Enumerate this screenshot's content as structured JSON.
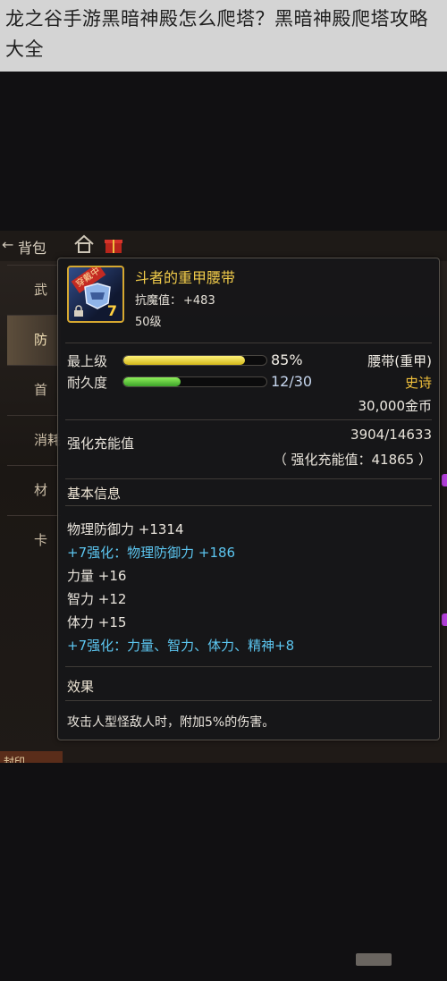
{
  "header": {
    "title": "龙之谷手游黑暗神殿怎么爬塔？黑暗神殿爬塔攻略大全"
  },
  "game": {
    "topbar": {
      "back_glyph": "←",
      "bag_label": "背包"
    },
    "sidebar": {
      "tabs": [
        "武",
        "防",
        "首",
        "消耗",
        "材",
        "卡"
      ],
      "bottom_label": "封印"
    },
    "item": {
      "badge": "穿戴中",
      "icon_level": "7",
      "name": "斗者的重甲腰带",
      "attr_label": "抗魔值：",
      "attr_value": "+483",
      "level": "50级",
      "top_level_label": "最上级",
      "top_level_value": "85%",
      "top_level_fraction": 0.85,
      "durability_label": "耐久度",
      "durability_value": "12/30",
      "durability_fraction": 0.4,
      "type": "腰带(重甲)",
      "rarity": "史诗",
      "price": "30,000金币",
      "charge_label": "强化充能值",
      "charge_value": "3904/14633",
      "charge_sub": "（ 强化充能值：41865 ）",
      "basic_info_title": "基本信息",
      "info_lines": [
        {
          "text": "物理防御力 +1314",
          "style": "white"
        },
        {
          "text": "+7强化：物理防御力 +186",
          "style": "blue"
        },
        {
          "text": "力量 +16",
          "style": "white"
        },
        {
          "text": "智力 +12",
          "style": "white"
        },
        {
          "text": "体力 +15",
          "style": "white"
        },
        {
          "text": "+7强化：力量、智力、体力、精神+8",
          "style": "blue"
        }
      ],
      "effect_title": "效果",
      "effect_text": "攻击人型怪敌人时，附加5%的伤害。"
    }
  },
  "colors": {
    "title_gold": "#f2cc4a",
    "epic_gold": "#f1c13c",
    "enhance_blue": "#5cc6f0",
    "accent_purple": "#b23ed8"
  }
}
